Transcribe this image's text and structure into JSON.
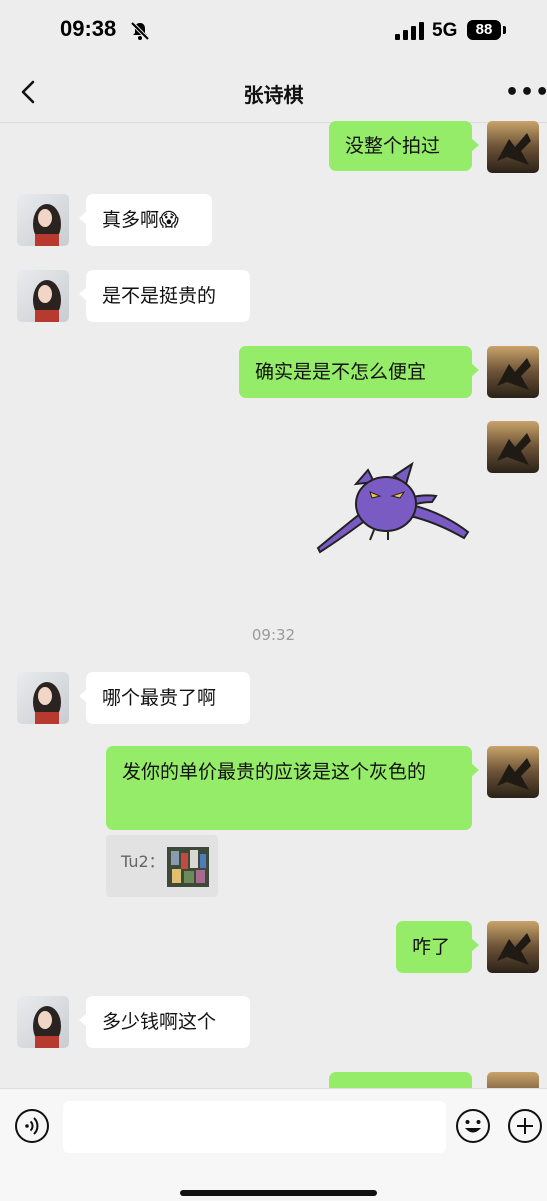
{
  "status_bar": {
    "time": "09:38",
    "network": "5G",
    "battery": "88"
  },
  "nav": {
    "title": "张诗棋",
    "back_icon": "chevron-left-icon",
    "more_icon": "more-horizontal-icon"
  },
  "messages": [
    {
      "side": "out",
      "text": "没整个拍过"
    },
    {
      "side": "in",
      "text": "真多啊😱"
    },
    {
      "side": "in",
      "text": "是不是挺贵的"
    },
    {
      "side": "out",
      "text": "确实是是不怎么便宜"
    },
    {
      "side": "out",
      "type": "sticker",
      "sticker": "purple-bat-creature"
    },
    {
      "side": "in",
      "text": "哪个最贵了啊"
    },
    {
      "side": "out",
      "text": "发你的单价最贵的应该是这个灰色的"
    },
    {
      "side": "out",
      "text": "咋了"
    },
    {
      "side": "in",
      "text": "多少钱啊这个"
    }
  ],
  "timestamp": "09:32",
  "quote": {
    "label": "Tu2："
  },
  "input_bar": {
    "placeholder": "",
    "voice_icon": "voice-icon",
    "emoji_icon": "emoji-icon",
    "plus_icon": "plus-icon"
  },
  "colors": {
    "background": "#ededed",
    "outgoing_bubble": "#95ec69",
    "incoming_bubble": "#ffffff"
  }
}
